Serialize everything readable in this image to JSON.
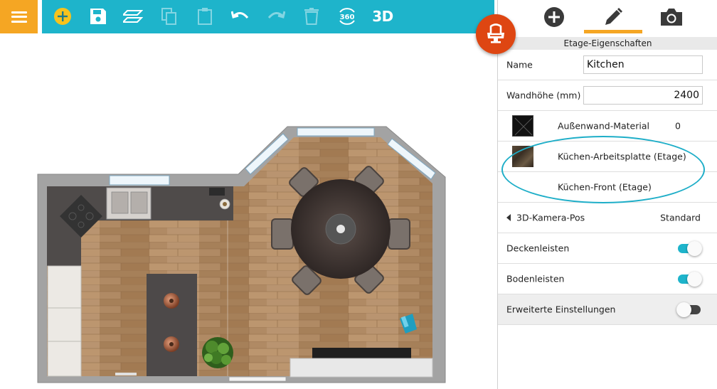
{
  "colors": {
    "toolbar": "#1eb4cb",
    "menu_button": "#f5a623",
    "fab": "#de4612",
    "accent": "#f5a623",
    "toggle_on": "#1eb4cb",
    "highlight": "#1eaec8"
  },
  "toolbar": {
    "menu_icon": "hamburger-icon",
    "items": [
      {
        "icon": "add-circle-icon",
        "enabled": true
      },
      {
        "icon": "save-icon",
        "enabled": true
      },
      {
        "icon": "floors-icon",
        "enabled": true
      },
      {
        "icon": "copy-icon",
        "enabled": false
      },
      {
        "icon": "paste-icon",
        "enabled": false
      },
      {
        "icon": "undo-icon",
        "enabled": true
      },
      {
        "icon": "redo-icon",
        "enabled": false
      },
      {
        "icon": "trash-icon",
        "enabled": false
      },
      {
        "icon": "360-view-icon",
        "label": "360",
        "enabled": true
      },
      {
        "icon": "3d-view",
        "label": "3D",
        "enabled": true
      }
    ],
    "furniture_button_icon": "armchair-icon"
  },
  "panel": {
    "tabs": [
      {
        "icon": "add-icon",
        "active": false
      },
      {
        "icon": "pencil-icon",
        "active": true
      },
      {
        "icon": "camera-icon",
        "active": false
      }
    ],
    "header": "Etage-Eigenschaften",
    "name_label": "Name",
    "name_value": "Kitchen",
    "wall_height_label": "Wandhöhe (mm)",
    "wall_height_value": "2400",
    "exterior_wall_material_label": "Außenwand-Material",
    "exterior_wall_material_value": "0",
    "countertop_label": "Küchen-Arbeitsplatte (Etage)",
    "front_label": "Küchen-Front (Etage)",
    "camera_label": "3D-Kamera-Pos",
    "camera_value": "Standard",
    "ceiling_moldings_label": "Deckenleisten",
    "ceiling_moldings_on": true,
    "baseboards_label": "Bodenleisten",
    "baseboards_on": true,
    "advanced_label": "Erweiterte Einstellungen",
    "advanced_on": false
  }
}
